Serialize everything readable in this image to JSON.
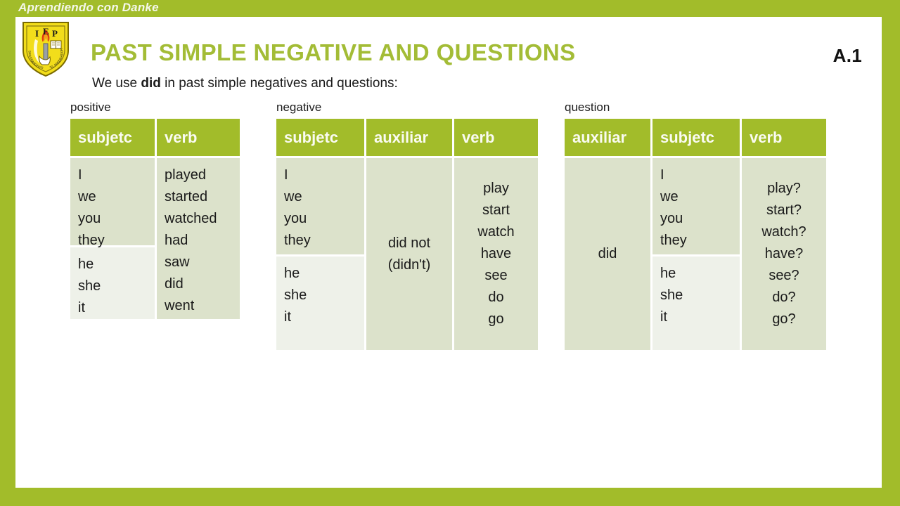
{
  "banner": {
    "title": "Aprendiendo con Danke"
  },
  "header": {
    "title": "PAST SIMPLE NEGATIVE AND QUESTIONS",
    "slide_code": "A.1",
    "subtitle_before": "We use ",
    "subtitle_bold": "did",
    "subtitle_after": " in past simple negatives and questions:"
  },
  "logo": {
    "letters": [
      "I",
      "E",
      "P"
    ],
    "alt": "school-crest-logo"
  },
  "colors": {
    "brand_green": "#A2BC2A",
    "title_green": "#A3BC36",
    "cell_dark": "#DDE3CC",
    "cell_light": "#EEF1E9",
    "header_text": "#FAFBF2",
    "body_text": "#1A1A1A",
    "logo_yellow": "#F2DD1B"
  },
  "tables": [
    {
      "caption": "positive",
      "headers": [
        "subjetc",
        "verb"
      ],
      "columns": [
        {
          "name": "subject",
          "cells": [
            {
              "shade": "dark",
              "lines": [
                "I",
                "we",
                "you",
                "they"
              ]
            },
            {
              "shade": "light",
              "lines": [
                "he",
                "she",
                "it"
              ]
            }
          ]
        },
        {
          "name": "verb",
          "cells": [
            {
              "shade": "dark",
              "lines": [
                "played",
                "started",
                "watched",
                "had",
                "saw",
                "did",
                "went"
              ]
            }
          ]
        }
      ]
    },
    {
      "caption": "negative",
      "headers": [
        "subjetc",
        "auxiliar",
        "verb"
      ],
      "columns": [
        {
          "name": "subject",
          "cells": [
            {
              "shade": "dark",
              "lines": [
                "I",
                "we",
                "you",
                "they"
              ]
            },
            {
              "shade": "light",
              "lines": [
                "he",
                "she",
                "it"
              ]
            }
          ]
        },
        {
          "name": "auxiliary",
          "cells": [
            {
              "shade": "dark",
              "center": true,
              "lines": [
                "did not",
                "(didn't)"
              ]
            }
          ]
        },
        {
          "name": "verb",
          "cells": [
            {
              "shade": "dark",
              "center": true,
              "lines": [
                "play",
                "start",
                "watch",
                "have",
                "see",
                "do",
                "go"
              ]
            }
          ]
        }
      ]
    },
    {
      "caption": "question",
      "headers": [
        "auxiliar",
        "subjetc",
        "verb"
      ],
      "columns": [
        {
          "name": "auxiliary",
          "cells": [
            {
              "shade": "dark",
              "center": true,
              "lines": [
                "did"
              ]
            }
          ]
        },
        {
          "name": "subject",
          "cells": [
            {
              "shade": "dark",
              "lines": [
                "I",
                "we",
                "you",
                "they"
              ]
            },
            {
              "shade": "light",
              "lines": [
                "he",
                "she",
                "it"
              ]
            }
          ]
        },
        {
          "name": "verb",
          "cells": [
            {
              "shade": "dark",
              "center": true,
              "lines": [
                "play?",
                "start?",
                "watch?",
                "have?",
                "see?",
                "do?",
                "go?"
              ]
            }
          ]
        }
      ]
    }
  ]
}
